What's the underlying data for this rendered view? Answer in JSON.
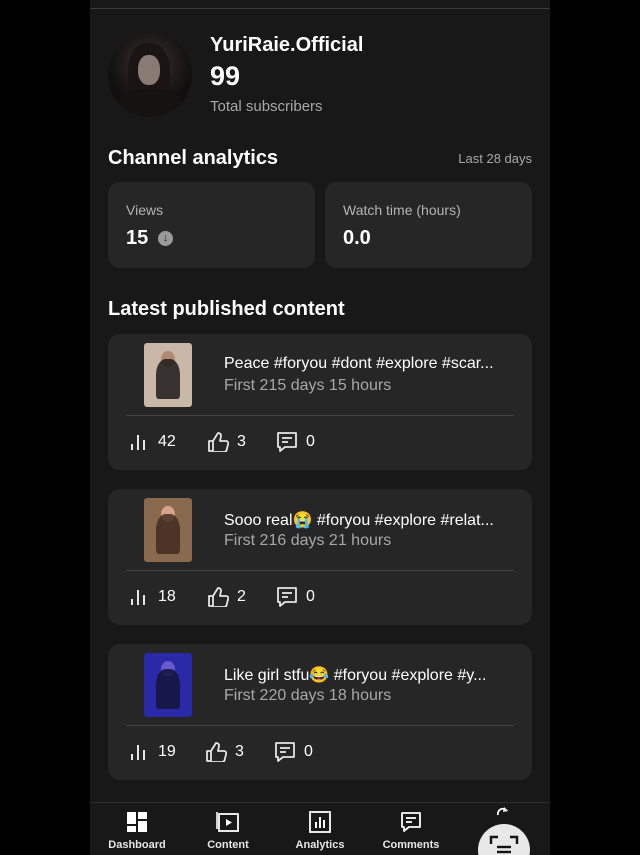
{
  "profile": {
    "channel_name": "YuriRaie.Official",
    "subscriber_count": "99",
    "subscriber_label": "Total subscribers",
    "avatar_icon": "profile-photo"
  },
  "analytics": {
    "title": "Channel analytics",
    "range": "Last 28 days",
    "views_label": "Views",
    "views_value": "15",
    "views_trend_icon": "down-arrow-icon",
    "watch_label": "Watch time (hours)",
    "watch_value": "0.0"
  },
  "latest": {
    "title": "Latest published content",
    "videos": [
      {
        "title": "Peace #foryou #dont #explore #scar...",
        "subtitle": "First 215 days 15 hours",
        "views": "42",
        "likes": "3",
        "comments": "0",
        "thumb_color": "#c9b8a8"
      },
      {
        "title": "Sooo real😭 #foryou #explore #relat...",
        "subtitle": "First 216 days 21 hours",
        "views": "18",
        "likes": "2",
        "comments": "0",
        "thumb_color": "#8a6a4e"
      },
      {
        "title": "Like girl stfu😂 #foryou #explore #y...",
        "subtitle": "First 220 days 18 hours",
        "views": "19",
        "likes": "3",
        "comments": "0",
        "thumb_color": "#2a2aa8"
      }
    ]
  },
  "nav": {
    "items": [
      {
        "label": "Dashboard",
        "icon": "dashboard-icon"
      },
      {
        "label": "Content",
        "icon": "content-icon"
      },
      {
        "label": "Analytics",
        "icon": "analytics-icon"
      },
      {
        "label": "Comments",
        "icon": "comments-icon"
      }
    ],
    "fab_icon": "scan-icon"
  }
}
